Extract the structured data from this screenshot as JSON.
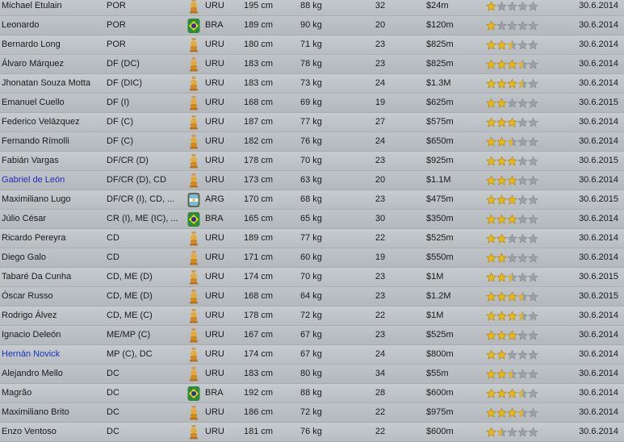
{
  "colors": {
    "star_gold": "#e8b818",
    "star_grey": "#9aa0a6",
    "link_blue": "#1b2fb8"
  },
  "players": [
    {
      "name": "Michael Etulain",
      "pos": "POR",
      "nat": "URU",
      "flag": "uruguay-shield-icon",
      "height": "195 cm",
      "weight": "88 kg",
      "age": "32",
      "value": "$24m",
      "rating": 1.0,
      "contract": "30.6.2014",
      "link": false
    },
    {
      "name": "Leonardo",
      "pos": "POR",
      "nat": "BRA",
      "flag": "brazil-shield-icon",
      "height": "189 cm",
      "weight": "90 kg",
      "age": "20",
      "value": "$120m",
      "rating": 1.0,
      "contract": "30.6.2014",
      "link": false
    },
    {
      "name": "Bernardo Long",
      "pos": "POR",
      "nat": "URU",
      "flag": "uruguay-shield-icon",
      "height": "180 cm",
      "weight": "71 kg",
      "age": "23",
      "value": "$825m",
      "rating": 2.5,
      "contract": "30.6.2014",
      "link": false
    },
    {
      "name": "Álvaro Márquez",
      "pos": "DF (DC)",
      "nat": "URU",
      "flag": "uruguay-shield-icon",
      "height": "183 cm",
      "weight": "78 kg",
      "age": "23",
      "value": "$825m",
      "rating": 3.5,
      "contract": "30.6.2014",
      "link": false
    },
    {
      "name": "Jhonatan Souza Motta",
      "pos": "DF (DIC)",
      "nat": "URU",
      "flag": "uruguay-shield-icon",
      "height": "183 cm",
      "weight": "73 kg",
      "age": "24",
      "value": "$1.3M",
      "rating": 3.5,
      "contract": "30.6.2014",
      "link": false
    },
    {
      "name": "Emanuel Cuello",
      "pos": "DF (I)",
      "nat": "URU",
      "flag": "uruguay-shield-icon",
      "height": "168 cm",
      "weight": "69 kg",
      "age": "19",
      "value": "$625m",
      "rating": 2.0,
      "contract": "30.6.2015",
      "link": false
    },
    {
      "name": "Federico Velázquez",
      "pos": "DF (C)",
      "nat": "URU",
      "flag": "uruguay-shield-icon",
      "height": "187 cm",
      "weight": "77 kg",
      "age": "27",
      "value": "$575m",
      "rating": 3.0,
      "contract": "30.6.2014",
      "link": false
    },
    {
      "name": "Fernando Rímolli",
      "pos": "DF (C)",
      "nat": "URU",
      "flag": "uruguay-shield-icon",
      "height": "182 cm",
      "weight": "76 kg",
      "age": "24",
      "value": "$650m",
      "rating": 2.5,
      "contract": "30.6.2014",
      "link": false
    },
    {
      "name": "Fabián Vargas",
      "pos": "DF/CR (D)",
      "nat": "URU",
      "flag": "uruguay-shield-icon",
      "height": "178 cm",
      "weight": "70 kg",
      "age": "23",
      "value": "$925m",
      "rating": 3.0,
      "contract": "30.6.2015",
      "link": false
    },
    {
      "name": "Gabriel de León",
      "pos": "DF/CR (D), CD",
      "nat": "URU",
      "flag": "uruguay-shield-icon",
      "height": "173 cm",
      "weight": "63 kg",
      "age": "20",
      "value": "$1.1M",
      "rating": 3.0,
      "contract": "30.6.2014",
      "link": true
    },
    {
      "name": "Maximiliano Lugo",
      "pos": "DF/CR (I), CD, ...",
      "nat": "ARG",
      "flag": "argentina-shield-icon",
      "height": "170 cm",
      "weight": "68 kg",
      "age": "23",
      "value": "$475m",
      "rating": 3.0,
      "contract": "30.6.2015",
      "link": false
    },
    {
      "name": "Júlio César",
      "pos": "CR (I), ME (IC), ...",
      "nat": "BRA",
      "flag": "brazil-shield-icon",
      "height": "165 cm",
      "weight": "65 kg",
      "age": "30",
      "value": "$350m",
      "rating": 3.0,
      "contract": "30.6.2014",
      "link": false
    },
    {
      "name": "Ricardo Pereyra",
      "pos": "CD",
      "nat": "URU",
      "flag": "uruguay-shield-icon",
      "height": "189 cm",
      "weight": "77 kg",
      "age": "22",
      "value": "$525m",
      "rating": 2.0,
      "contract": "30.6.2014",
      "link": false
    },
    {
      "name": "Diego Galo",
      "pos": "CD",
      "nat": "URU",
      "flag": "uruguay-shield-icon",
      "height": "171 cm",
      "weight": "60 kg",
      "age": "19",
      "value": "$550m",
      "rating": 2.0,
      "contract": "30.6.2014",
      "link": false
    },
    {
      "name": "Tabaré Da Cunha",
      "pos": "CD, ME (D)",
      "nat": "URU",
      "flag": "uruguay-shield-icon",
      "height": "174 cm",
      "weight": "70 kg",
      "age": "23",
      "value": "$1M",
      "rating": 2.5,
      "contract": "30.6.2015",
      "link": false
    },
    {
      "name": "Óscar Russo",
      "pos": "CD, ME (D)",
      "nat": "URU",
      "flag": "uruguay-shield-icon",
      "height": "168 cm",
      "weight": "64 kg",
      "age": "23",
      "value": "$1.2M",
      "rating": 3.5,
      "contract": "30.6.2015",
      "link": false
    },
    {
      "name": "Rodrigo Álvez",
      "pos": "CD, ME (C)",
      "nat": "URU",
      "flag": "uruguay-shield-icon",
      "height": "178 cm",
      "weight": "72 kg",
      "age": "22",
      "value": "$1M",
      "rating": 3.5,
      "contract": "30.6.2014",
      "link": false
    },
    {
      "name": "Ignacio Deleón",
      "pos": "ME/MP (C)",
      "nat": "URU",
      "flag": "uruguay-shield-icon",
      "height": "167 cm",
      "weight": "67 kg",
      "age": "23",
      "value": "$525m",
      "rating": 3.0,
      "contract": "30.6.2014",
      "link": false
    },
    {
      "name": "Hernán Novick",
      "pos": "MP (C), DC",
      "nat": "URU",
      "flag": "uruguay-shield-icon",
      "height": "174 cm",
      "weight": "67 kg",
      "age": "24",
      "value": "$800m",
      "rating": 2.0,
      "contract": "30.6.2014",
      "link": true
    },
    {
      "name": "Alejandro Mello",
      "pos": "DC",
      "nat": "URU",
      "flag": "uruguay-shield-icon",
      "height": "183 cm",
      "weight": "80 kg",
      "age": "34",
      "value": "$55m",
      "rating": 2.5,
      "contract": "30.6.2014",
      "link": false
    },
    {
      "name": "Magrão",
      "pos": "DC",
      "nat": "BRA",
      "flag": "brazil-shield-icon",
      "height": "192 cm",
      "weight": "88 kg",
      "age": "28",
      "value": "$600m",
      "rating": 3.5,
      "contract": "30.6.2014",
      "link": false
    },
    {
      "name": "Maximiliano Brito",
      "pos": "DC",
      "nat": "URU",
      "flag": "uruguay-shield-icon",
      "height": "186 cm",
      "weight": "72 kg",
      "age": "22",
      "value": "$975m",
      "rating": 3.5,
      "contract": "30.6.2014",
      "link": false
    },
    {
      "name": "Enzo Ventoso",
      "pos": "DC",
      "nat": "URU",
      "flag": "uruguay-shield-icon",
      "height": "181 cm",
      "weight": "76 kg",
      "age": "22",
      "value": "$600m",
      "rating": 1.5,
      "contract": "30.6.2014",
      "link": false
    }
  ]
}
